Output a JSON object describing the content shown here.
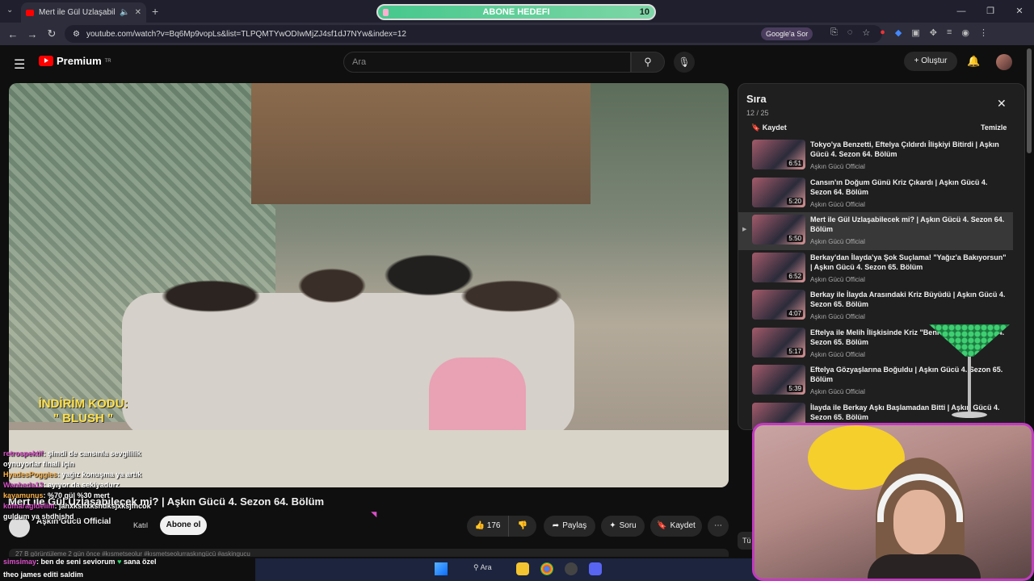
{
  "browser": {
    "tab_title": "Mert ile Gül Uzlaşabilecek m",
    "url": "youtube.com/watch?v=Bq6Mp9vopLs&list=TLPQMTYwODIwMjZJ4sf1dJ7NYw&index=12",
    "google_sor_label": "Google'a Sor"
  },
  "stream_overlay": {
    "goal_label": "ABONE HEDEFI",
    "goal_count": "10",
    "promo_line1": "İNDİRİM KODU:",
    "promo_line2": "\" BLUSH \""
  },
  "youtube": {
    "logo_text": "Premium",
    "logo_sup": "TR",
    "search_placeholder": "Ara",
    "create_label": "Oluştur",
    "video_title": "Mert ile Gül Uzlaşabilecek mi? | Aşkın Gücü 4. Sezon 64. Bölüm",
    "channel_name": "Aşkın Gücü Official",
    "join_label": "Katıl",
    "subscribe_label": "Abone ol",
    "like_count": "176",
    "share_label": "Paylaş",
    "ask_label": "Soru",
    "save_label": "Kaydet",
    "description_peek": "27 B görüntüleme  2 gün önce  #kısmetseolur #kısmetseolurraskıngücü #askingucu",
    "tu_label": "Tü"
  },
  "queue": {
    "title": "Sıra",
    "count": "12 / 25",
    "save_label": "Kaydet",
    "clear_label": "Temizle",
    "items": [
      {
        "title": "Tokyo'ya Benzetti, Eftelya Çıldırdı İlişkiyi Bitirdi | Aşkın Gücü 4. Sezon 64. Bölüm",
        "channel": "Aşkın Gücü Official",
        "duration": "6:51"
      },
      {
        "title": "Cansın'ın Doğum Günü Kriz Çıkardı | Aşkın Gücü 4. Sezon 64. Bölüm",
        "channel": "Aşkın Gücü Official",
        "duration": "5:20"
      },
      {
        "title": "Mert ile Gül Uzlaşabilecek mi? | Aşkın Gücü 4. Sezon 64. Bölüm",
        "channel": "Aşkın Gücü Official",
        "duration": "5:50"
      },
      {
        "title": "Berkay'dan İlayda'ya Şok Suçlama! \"Yağız'a Bakıyorsun\" | Aşkın Gücü 4. Sezon 65. Bölüm",
        "channel": "Aşkın Gücü Official",
        "duration": "6:52"
      },
      {
        "title": "Berkay ile İlayda Arasındaki Kriz Büyüdü | Aşkın Gücü 4. Sezon 65. Bölüm",
        "channel": "Aşkın Gücü Official",
        "duration": "4:07"
      },
      {
        "title": "Eftelya ile Melih İlişkisinde Kriz \"Beni Al... Aşkın Gücü 4. Sezon 65. Bölüm",
        "channel": "Aşkın Gücü Official",
        "duration": "5:17"
      },
      {
        "title": "Eftelya Gözyaşlarına Boğuldu | Aşkın Gücü 4. Sezon 65. Bölüm",
        "channel": "Aşkın Gücü Official",
        "duration": "5:39"
      },
      {
        "title": "İlayda ile Berkay Aşkı Başlamadan Bitti | Aşkın Gücü 4. Sezon 65. Bölüm",
        "channel": "Aşkın Gücü Official",
        "duration": ""
      }
    ]
  },
  "chat": {
    "overlay": [
      {
        "user": "retrospektif",
        "text": ": şimdi de cansınla sevgililik"
      },
      {
        "user": "",
        "text": "oynuyorlar finali için"
      },
      {
        "user": "HyadesPoggies",
        "text": ": yağız konuşma ya artık"
      },
      {
        "user": "Wanheda13",
        "text": ": ayıyor da sekiyadurz"
      },
      {
        "user": "kayamunus",
        "text": ": %70 gül %30 mert"
      },
      {
        "user": "kumaragidelim",
        "text": ": jahxkshxkshdksjxksjfhcok"
      },
      {
        "user": "",
        "text": "guldum ya shdhjshd"
      }
    ],
    "bottom": [
      {
        "user": "simsimay",
        "text": ": ben de seni seviorum",
        "tail": "sana özel"
      },
      {
        "user": "",
        "text": "theo james editi saldim",
        "tail": ""
      }
    ]
  },
  "taskbar": {
    "search_label": "Ara"
  }
}
